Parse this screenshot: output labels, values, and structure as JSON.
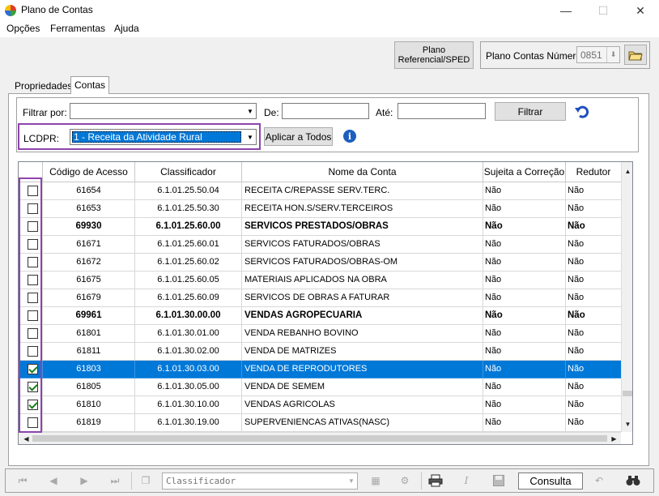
{
  "window": {
    "title": "Plano de Contas",
    "minimize": "—",
    "maximize": "☐",
    "close": "✕"
  },
  "menu": [
    "Opções",
    "Ferramentas",
    "Ajuda"
  ],
  "top": {
    "plano_referencial_label": "Plano Referencial/SPED",
    "plano_numero_label": "Plano Contas Número",
    "plano_numero_value": "0851"
  },
  "tabs": [
    "Propriedades",
    "Contas"
  ],
  "filter": {
    "filtrar_por_label": "Filtrar por:",
    "filtrar_por_value": "",
    "de_label": "De:",
    "de_value": "",
    "ate_label": "Até:",
    "ate_value": "",
    "filtrar_button": "Filtrar",
    "lcdpr_label": "LCDPR:",
    "lcdpr_value": "1 - Receita da Atividade Rural",
    "aplicar_button": "Aplicar a Todos"
  },
  "grid": {
    "columns": [
      "",
      "Código de Acesso",
      "Classificador",
      "Nome da Conta",
      "Sujeita a Correção",
      "Redutor"
    ],
    "rows": [
      {
        "checked": false,
        "codigo": "61654",
        "classificador": "6.1.01.25.50.04",
        "nome": "RECEITA C/REPASSE SERV.TERC.",
        "sujeita": "Não",
        "redutor": "Não",
        "bold": false,
        "selected": false
      },
      {
        "checked": false,
        "codigo": "61653",
        "classificador": "6.1.01.25.50.30",
        "nome": "RECEITA HON.S/SERV.TERCEIROS",
        "sujeita": "Não",
        "redutor": "Não",
        "bold": false,
        "selected": false
      },
      {
        "checked": false,
        "codigo": "69930",
        "classificador": "6.1.01.25.60.00",
        "nome": "SERVICOS PRESTADOS/OBRAS",
        "sujeita": "Não",
        "redutor": "Não",
        "bold": true,
        "selected": false
      },
      {
        "checked": false,
        "codigo": "61671",
        "classificador": "6.1.01.25.60.01",
        "nome": "SERVICOS FATURADOS/OBRAS",
        "sujeita": "Não",
        "redutor": "Não",
        "bold": false,
        "selected": false
      },
      {
        "checked": false,
        "codigo": "61672",
        "classificador": "6.1.01.25.60.02",
        "nome": "SERVICOS FATURADOS/OBRAS-OM",
        "sujeita": "Não",
        "redutor": "Não",
        "bold": false,
        "selected": false
      },
      {
        "checked": false,
        "codigo": "61675",
        "classificador": "6.1.01.25.60.05",
        "nome": "MATERIAIS APLICADOS NA OBRA",
        "sujeita": "Não",
        "redutor": "Não",
        "bold": false,
        "selected": false
      },
      {
        "checked": false,
        "codigo": "61679",
        "classificador": "6.1.01.25.60.09",
        "nome": "SERVICOS DE OBRAS A FATURAR",
        "sujeita": "Não",
        "redutor": "Não",
        "bold": false,
        "selected": false
      },
      {
        "checked": false,
        "codigo": "69961",
        "classificador": "6.1.01.30.00.00",
        "nome": "VENDAS AGROPECUARIA",
        "sujeita": "Não",
        "redutor": "Não",
        "bold": true,
        "selected": false
      },
      {
        "checked": false,
        "codigo": "61801",
        "classificador": "6.1.01.30.01.00",
        "nome": "VENDA REBANHO BOVINO",
        "sujeita": "Não",
        "redutor": "Não",
        "bold": false,
        "selected": false
      },
      {
        "checked": false,
        "codigo": "61811",
        "classificador": "6.1.01.30.02.00",
        "nome": "VENDA DE MATRIZES",
        "sujeita": "Não",
        "redutor": "Não",
        "bold": false,
        "selected": false
      },
      {
        "checked": true,
        "codigo": "61803",
        "classificador": "6.1.01.30.03.00",
        "nome": "VENDA DE REPRODUTORES",
        "sujeita": "Não",
        "redutor": "Não",
        "bold": false,
        "selected": true
      },
      {
        "checked": true,
        "codigo": "61805",
        "classificador": "6.1.01.30.05.00",
        "nome": "VENDA DE SEMEM",
        "sujeita": "Não",
        "redutor": "Não",
        "bold": false,
        "selected": false
      },
      {
        "checked": true,
        "codigo": "61810",
        "classificador": "6.1.01.30.10.00",
        "nome": "VENDAS AGRICOLAS",
        "sujeita": "Não",
        "redutor": "Não",
        "bold": false,
        "selected": false
      },
      {
        "checked": false,
        "codigo": "61819",
        "classificador": "6.1.01.30.19.00",
        "nome": "SUPERVENIENCAS ATIVAS(NASC)",
        "sujeita": "Não",
        "redutor": "Não",
        "bold": false,
        "selected": false
      }
    ]
  },
  "bottom": {
    "search_placeholder": "Classificador",
    "status": "Consulta"
  },
  "colors": {
    "selection": "#0078d7",
    "highlight": "#8e44ad",
    "check": "#1a7f1a"
  }
}
